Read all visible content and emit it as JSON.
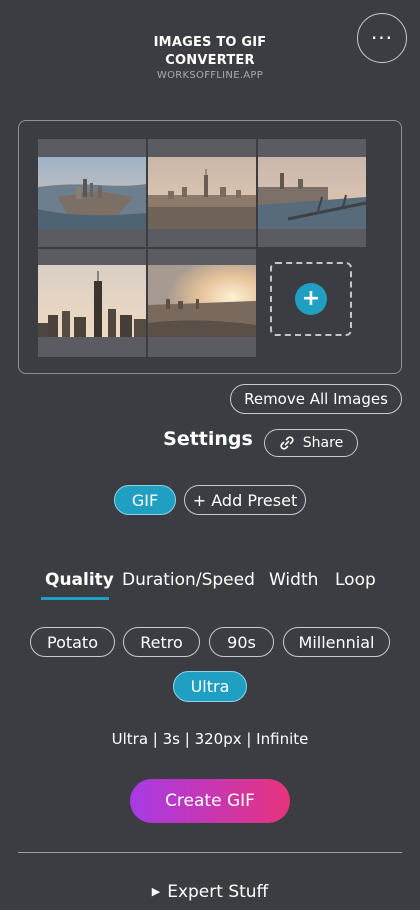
{
  "header": {
    "title": "IMAGES TO GIF CONVERTER",
    "subtitle": "WORKSOFFLINE.APP",
    "menu_icon": "ellipsis-icon",
    "menu_glyph": "···"
  },
  "images": {
    "count": 5,
    "add_icon": "plus-icon",
    "add_glyph": "+"
  },
  "actions": {
    "remove_all": "Remove All Images"
  },
  "settings": {
    "title": "Settings",
    "share_label": "Share",
    "share_icon": "link-icon"
  },
  "presets": {
    "active": "GIF",
    "add_label": "+ Add Preset"
  },
  "tabs": [
    {
      "label": "Quality",
      "active": true
    },
    {
      "label": "Duration/Speed",
      "active": false
    },
    {
      "label": "Width",
      "active": false
    },
    {
      "label": "Loop",
      "active": false
    }
  ],
  "quality_options": [
    {
      "label": "Potato",
      "selected": false
    },
    {
      "label": "Retro",
      "selected": false
    },
    {
      "label": "90s",
      "selected": false
    },
    {
      "label": "Millennial",
      "selected": false
    },
    {
      "label": "Ultra",
      "selected": true
    }
  ],
  "summary": "Ultra | 3s | 320px | Infinite",
  "create_button": "Create GIF",
  "expert": {
    "label": "Expert Stuff",
    "icon": "triangle-right-icon",
    "glyph": "▶"
  },
  "colors": {
    "background": "#3c3d43",
    "accent": "#1f9fc1",
    "gradient_start": "#a73ae6",
    "gradient_end": "#e7337d"
  }
}
